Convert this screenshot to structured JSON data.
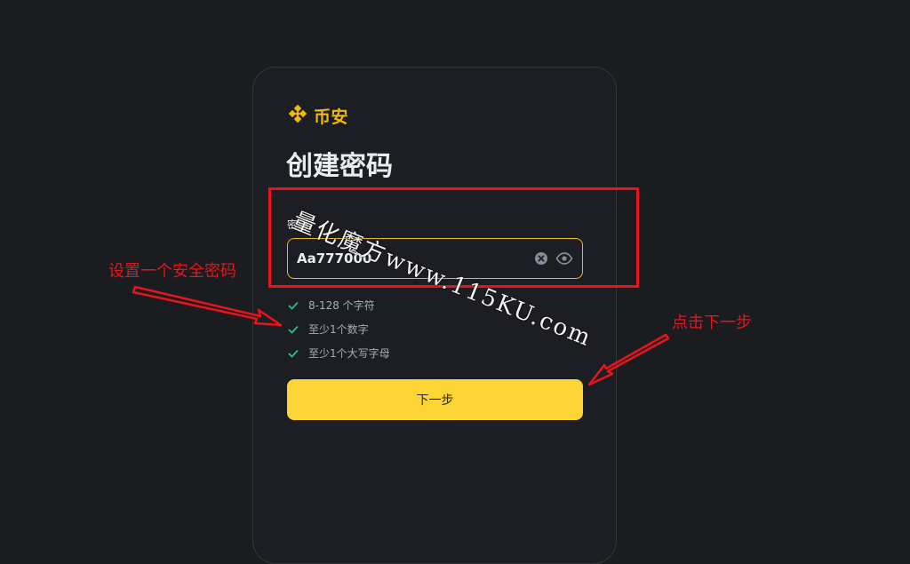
{
  "logo": {
    "text": "币安",
    "color": "#f0b90b",
    "icon": "binance-diamond-icon"
  },
  "page": {
    "title": "创建密码"
  },
  "password": {
    "label": "密码",
    "value": "Aa777000",
    "clear_icon": "clear-icon",
    "visibility_icon": "eye-icon"
  },
  "rules": [
    {
      "text": "8-128 个字符",
      "met": true
    },
    {
      "text": "至少1个数字",
      "met": true
    },
    {
      "text": "至少1个大写字母",
      "met": true
    }
  ],
  "next_button": {
    "label": "下一步",
    "color": "#fcd535"
  },
  "annotations": {
    "left": "设置一个安全密码",
    "right": "点击下一步",
    "color": "#e8141b"
  },
  "watermark": {
    "text": "量化魔方www.115KU.com"
  }
}
